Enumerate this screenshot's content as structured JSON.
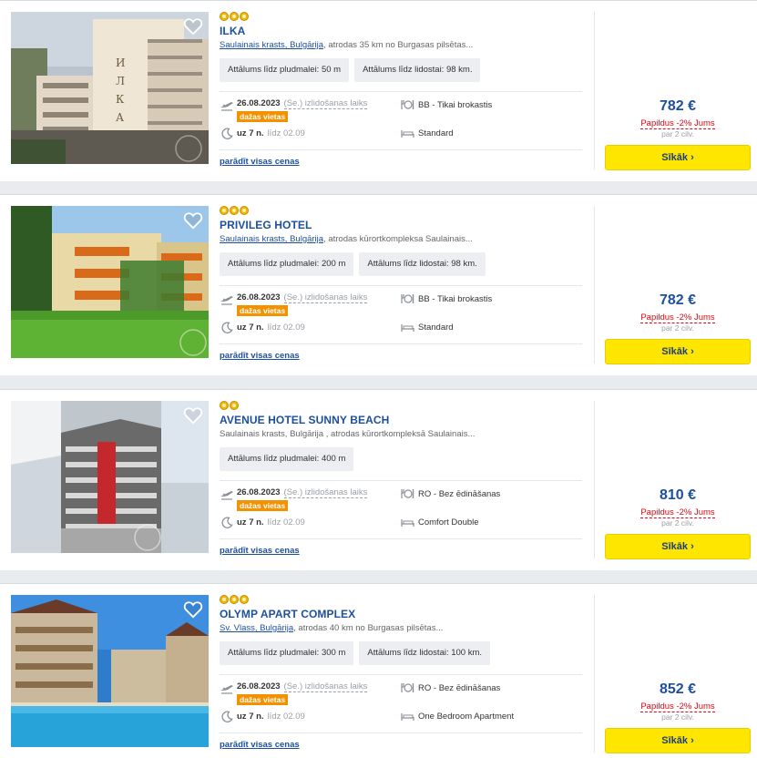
{
  "hotels": [
    {
      "stars": 3,
      "name": "ILKA",
      "location_link": "Saulainais krasts, Bulgārija",
      "location_text": ", atrodas 35 km no Burgasas pilsētas...",
      "chips": [
        "Attālums līdz pludmalei: 50 m",
        "Attālums līdz lidostai: 98 km."
      ],
      "date": "26.08.2023",
      "departure": "(Se.) izlidošanas laiks",
      "few": "dažas vietas",
      "nights": "uz 7 n.",
      "until": "līdz 02.09",
      "board": "BB - Tikai brokastis",
      "room": "Standard",
      "all_prices": "parādīt visas cenas",
      "price": "782 €",
      "extra": "Papildus -2% Jums",
      "per": "par 2 cilv.",
      "button": "Sīkāk ›",
      "photo": "ilka"
    },
    {
      "stars": 3,
      "name": "PRIVILEG HOTEL",
      "location_link": "Saulainais krasts, Bulgārija",
      "location_text": ", atrodas kūrortkompleksa Saulainais...",
      "chips": [
        "Attālums līdz pludmalei: 200 m",
        "Attālums līdz lidostai: 98 km."
      ],
      "date": "26.08.2023",
      "departure": "(Se.) izlidošanas laiks",
      "few": "dažas vietas",
      "nights": "uz 7 n.",
      "until": "līdz 02.09",
      "board": "BB - Tikai brokastis",
      "room": "Standard",
      "all_prices": "parādīt visas cenas",
      "price": "782 €",
      "extra": "Papildus -2% Jums",
      "per": "par 2 cilv.",
      "button": "Sīkāk ›",
      "photo": "privileg"
    },
    {
      "stars": 2,
      "name": "AVENUE HOTEL SUNNY BEACH",
      "location_link": "",
      "location_text": "Saulainais krasts, Bulgārija , atrodas kūrortkompleksā Saulainais...",
      "chips": [
        "Attālums līdz pludmalei: 400 m"
      ],
      "date": "26.08.2023",
      "departure": "(Se.) izlidošanas laiks",
      "few": "dažas vietas",
      "nights": "uz 7 n.",
      "until": "līdz 02.09",
      "board": "RO - Bez ēdināšanas",
      "room": "Comfort Double",
      "all_prices": "parādīt visas cenas",
      "price": "810 €",
      "extra": "Papildus -2% Jums",
      "per": "par 2 cilv.",
      "button": "Sīkāk ›",
      "photo": "avenue"
    },
    {
      "stars": 3,
      "name": "OLYMP APART COMPLEX",
      "location_link": "Sv. Vlass, Bulgārija",
      "location_text": ", atrodas 40 km no Burgasas pilsētas...",
      "chips": [
        "Attālums līdz pludmalei: 300 m",
        "Attālums līdz lidostai: 100 km."
      ],
      "date": "26.08.2023",
      "departure": "(Se.) izlidošanas laiks",
      "few": "dažas vietas",
      "nights": "uz 7 n.",
      "until": "līdz 02.09",
      "board": "RO - Bez ēdināšanas",
      "room": "One Bedroom Apartment",
      "all_prices": "parādīt visas cenas",
      "price": "852 €",
      "extra": "Papildus -2% Jums",
      "per": "par 2 cilv.",
      "button": "Sīkāk ›",
      "photo": "olymp"
    }
  ],
  "colors": {
    "brand_blue": "#1c4f9c",
    "button_yellow": "#ffe600",
    "badge_orange": "#f39200",
    "discount_red": "#e30613"
  },
  "icons": [
    "heart-icon",
    "star-icon",
    "plane-icon",
    "moon-icon",
    "dining-icon",
    "bed-icon"
  ]
}
